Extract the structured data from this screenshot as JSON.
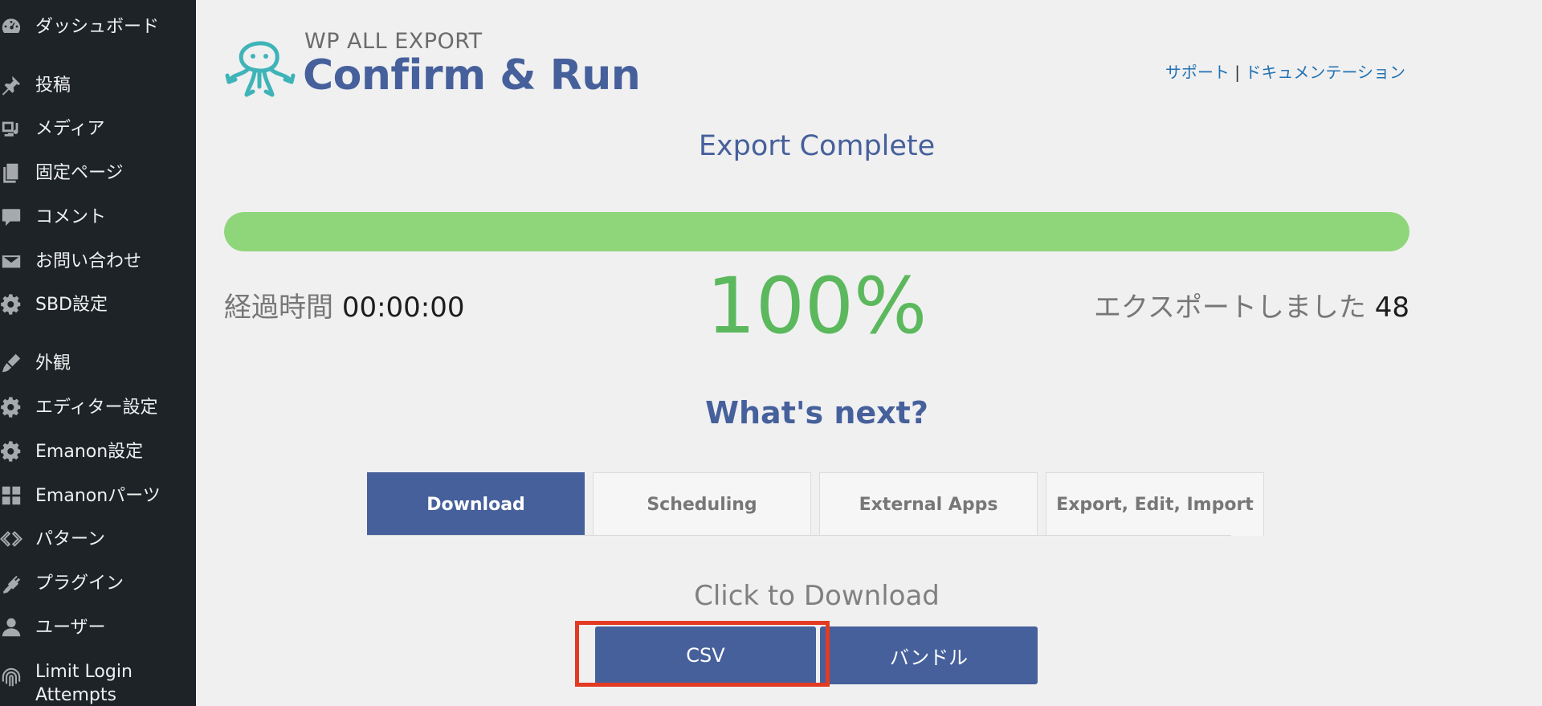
{
  "sidebar": {
    "items": [
      {
        "label": "ダッシュボード",
        "icon": "dashboard-icon"
      },
      {
        "label": "投稿",
        "icon": "pin-icon"
      },
      {
        "label": "メディア",
        "icon": "media-icon"
      },
      {
        "label": "固定ページ",
        "icon": "pages-icon"
      },
      {
        "label": "コメント",
        "icon": "comment-icon"
      },
      {
        "label": "お問い合わせ",
        "icon": "mail-icon"
      },
      {
        "label": "SBD設定",
        "icon": "gear-icon"
      },
      {
        "label": "外観",
        "icon": "brush-icon"
      },
      {
        "label": "エディター設定",
        "icon": "gear-icon"
      },
      {
        "label": "Emanon設定",
        "icon": "gear-icon"
      },
      {
        "label": "Emanonパーツ",
        "icon": "grid-icon"
      },
      {
        "label": "パターン",
        "icon": "pattern-icon"
      },
      {
        "label": "プラグイン",
        "icon": "plugin-icon"
      },
      {
        "label": "ユーザー",
        "icon": "user-icon"
      },
      {
        "label": "Limit Login\nAttempts",
        "icon": "fingerprint-icon"
      }
    ]
  },
  "header": {
    "brand_small": "WP ALL EXPORT",
    "title": "Confirm & Run",
    "link_support": "サポート",
    "link_separator": "|",
    "link_docs": "ドキュメンテーション"
  },
  "status": {
    "message": "Export Complete",
    "progress_percent": 100,
    "elapsed_label": "経過時間",
    "elapsed_value": "00:00:00",
    "percent_text": "100%",
    "exported_label": "エクスポートしました",
    "exported_count": "48"
  },
  "next": {
    "heading": "What's next?",
    "tabs": [
      {
        "label": "Download",
        "active": true
      },
      {
        "label": "Scheduling",
        "active": false
      },
      {
        "label": "External Apps",
        "active": false
      },
      {
        "label": "Export, Edit, Import",
        "active": false
      }
    ],
    "download_prompt": "Click to Download",
    "buttons": {
      "csv": "CSV",
      "bundle": "バンドル"
    }
  },
  "colors": {
    "accent": "#46609b",
    "progress": "#8fd67a",
    "percent_text": "#5cb85c",
    "highlight": "#e33b22"
  }
}
